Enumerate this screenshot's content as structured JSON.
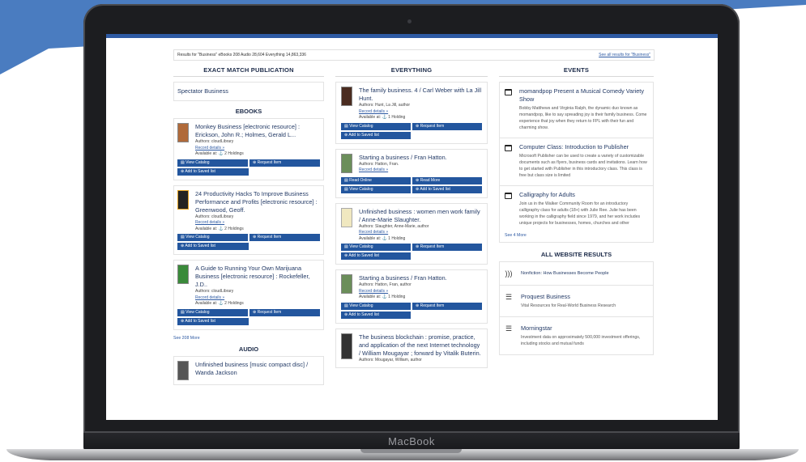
{
  "device": {
    "brand": "MacBook"
  },
  "results_bar": {
    "left": "Results for \"Business\"    eBooks 208    Audio 28,604    Everything 14,863,336",
    "right": "See all results for \"Business\""
  },
  "exact_match": {
    "heading": "EXACT MATCH PUBLICATION",
    "item": "Spectator Business"
  },
  "ebooks": {
    "heading": "EBOOKS",
    "items": [
      {
        "title": "Monkey Business [electronic resource] : Erickson, John R.; Holmes, Gerald L...",
        "authors": "Authors: cloudLibrary",
        "record": "Record details »",
        "available": "Available at: ⚓ 2 Holdings",
        "btn1": "View Catalog",
        "btn2": "Request Item",
        "btn3": "Add to Saved list"
      },
      {
        "title": "24 Productivity Hacks To Improve Business Performance and Profits [electronic resource] : Greenwood, Geoff.",
        "authors": "Authors: cloudLibrary",
        "record": "Record details »",
        "available": "Available at: ⚓ 2 Holdings",
        "btn1": "View Catalog",
        "btn2": "Request Item",
        "btn3": "Add to Saved list"
      },
      {
        "title": "A Guide to Running Your Own Marijuana Business [electronic resource] : Rockefeller, J.D..",
        "authors": "Authors: cloudLibrary",
        "record": "Record details »",
        "available": "Available at: ⚓ 2 Holdings",
        "btn1": "View Catalog",
        "btn2": "Request Item",
        "btn3": "Add to Saved list"
      }
    ],
    "see_more": "See 208 More"
  },
  "audio": {
    "heading": "AUDIO",
    "items": [
      {
        "title": "Unfinished business [music compact disc] / Wanda Jackson"
      }
    ]
  },
  "everything": {
    "heading": "EVERYTHING",
    "items": [
      {
        "title": "The family business. 4 / Carl Weber with La Jill Hunt.",
        "authors": "Authors: Hunt, La Jill, author",
        "record": "Record details »",
        "available": "Available at: ⚓ 1 Holding",
        "btn1": "View Catalog",
        "btn2": "Request Item",
        "btn3": "Add to Saved list"
      },
      {
        "title": "Starting a business / Fran Hatton.",
        "authors": "Authors: Hatton, Fran.",
        "record": "Record details »",
        "btn1": "Read Online",
        "btn2": "Read More",
        "btn3": "View Catalog",
        "btn4": "Add to Saved list"
      },
      {
        "title": "Unfinished business : women men work family / Anne-Marie Slaughter.",
        "authors": "Authors: Slaughter, Anne-Marie, author",
        "record": "Record details »",
        "available": "Available at: ⚓ 1 Holding",
        "btn1": "View Catalog",
        "btn2": "Request Item",
        "btn3": "Add to Saved list"
      },
      {
        "title": "Starting a business / Fran Hatton.",
        "authors": "Authors: Hatton, Fran, author",
        "record": "Record details »",
        "available": "Available at: ⚓ 1 Holding",
        "btn1": "View Catalog",
        "btn2": "Request Item",
        "btn3": "Add to Saved list"
      },
      {
        "title": "The business blockchain : promise, practice, and application of the next Internet technology / William Mougayar ; forward by Vitalik Buterin.",
        "authors": "Authors: Mougayar, William, author"
      }
    ]
  },
  "events": {
    "heading": "EVENTS",
    "items": [
      {
        "title": "momandpop Present a Musical Comedy Variety Show",
        "text": "Bobby Matthews and Virginia Ralph, the dynamic duo known as momandpop, like to say spreading joy is their family business. Come experience that joy when they return to FPL with their fun and charming show."
      },
      {
        "title": "Computer Class: Introduction to Publisher",
        "text": "Microsoft Publisher can be used to create a variety of customizable documents such as flyers, business cards and invitations. Learn how to get started with Publisher in this introductory class. This class is free but class size is limited"
      },
      {
        "title": "Calligraphy for Adults",
        "text": "Join us in the Walker Community Room for an introductory calligraphy class for adults (18+) with Julie Ree. Julie has been working in the calligraphy field since 1979, and her work includes unique projects for businesses, homes, churches and other"
      }
    ],
    "see_more": "See 4 More"
  },
  "website": {
    "heading": "ALL WEBSITE RESULTS",
    "items": [
      {
        "icon": "rss-icon",
        "title": "Nonfiction: How Businesses Become People",
        "text": ""
      },
      {
        "icon": "database-icon",
        "title": "Proquest Business",
        "text": "Vital Resources for Real-World Business Research"
      },
      {
        "icon": "database-icon",
        "title": "Morningstar",
        "text": "Investment data on approximately 500,000 investment offerings, including stocks and mutual funds"
      }
    ]
  },
  "colors": {
    "accent": "#2e5aa3",
    "button": "#23569e",
    "background_shape": "#4a7cc0"
  }
}
